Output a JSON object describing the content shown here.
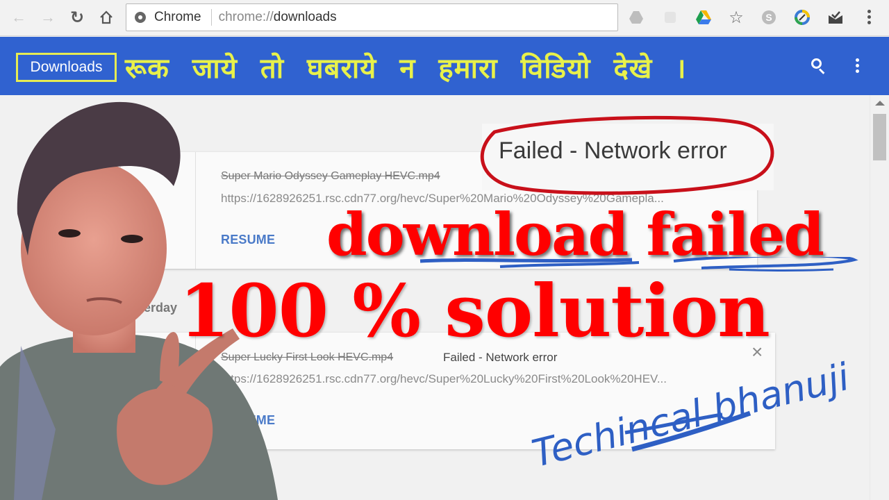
{
  "browser": {
    "nav": {
      "back_icon": "arrow-left-icon",
      "forward_icon": "arrow-right-icon",
      "reload_icon": "reload-icon",
      "home_icon": "home-icon"
    },
    "omnibox": {
      "site_label": "Chrome",
      "url_scheme": "chrome://",
      "url_path": "downloads"
    },
    "extensions": [
      "google-drive-gray-icon",
      "pocket-icon",
      "google-drive-icon",
      "star-icon",
      "skype-icon",
      "extension-circle-icon",
      "mail-check-icon",
      "menu-kebab-icon"
    ]
  },
  "header": {
    "title": "Downloads",
    "overlay_hindi": "रूक जाये तो घबराये न हमारा विडियो देखे ।",
    "search_icon": "search-icon",
    "menu_icon": "more-vert-icon"
  },
  "downloads": [
    {
      "filename": "Super Mario Odyssey Gameplay HEVC.mp4",
      "status": "Failed - Network error",
      "url": "https://1628926251.rsc.cdn77.org/hevc/Super%20Mario%20Odyssey%20Gamepla...",
      "action": "RESUME"
    },
    {
      "date_label": "Yesterday",
      "filename": "Super Lucky First Look HEVC.mp4",
      "status": "Failed - Network error",
      "url": "https://1628926251.rsc.cdn77.org/hevc/Super%20Lucky%20First%20Look%20HEV...",
      "action": "RESUME"
    }
  ],
  "overlay": {
    "callout": "Failed - Network error",
    "headline_line1": "download failed",
    "headline_line2": "100 % solution",
    "signature": "Techincal bhanuji",
    "colors": {
      "headline": "#ff0000",
      "callout_ring": "#c8101a",
      "header_bg": "#3062d0",
      "hindi_text": "#e8f14a",
      "ink": "#2e5fc4"
    }
  }
}
